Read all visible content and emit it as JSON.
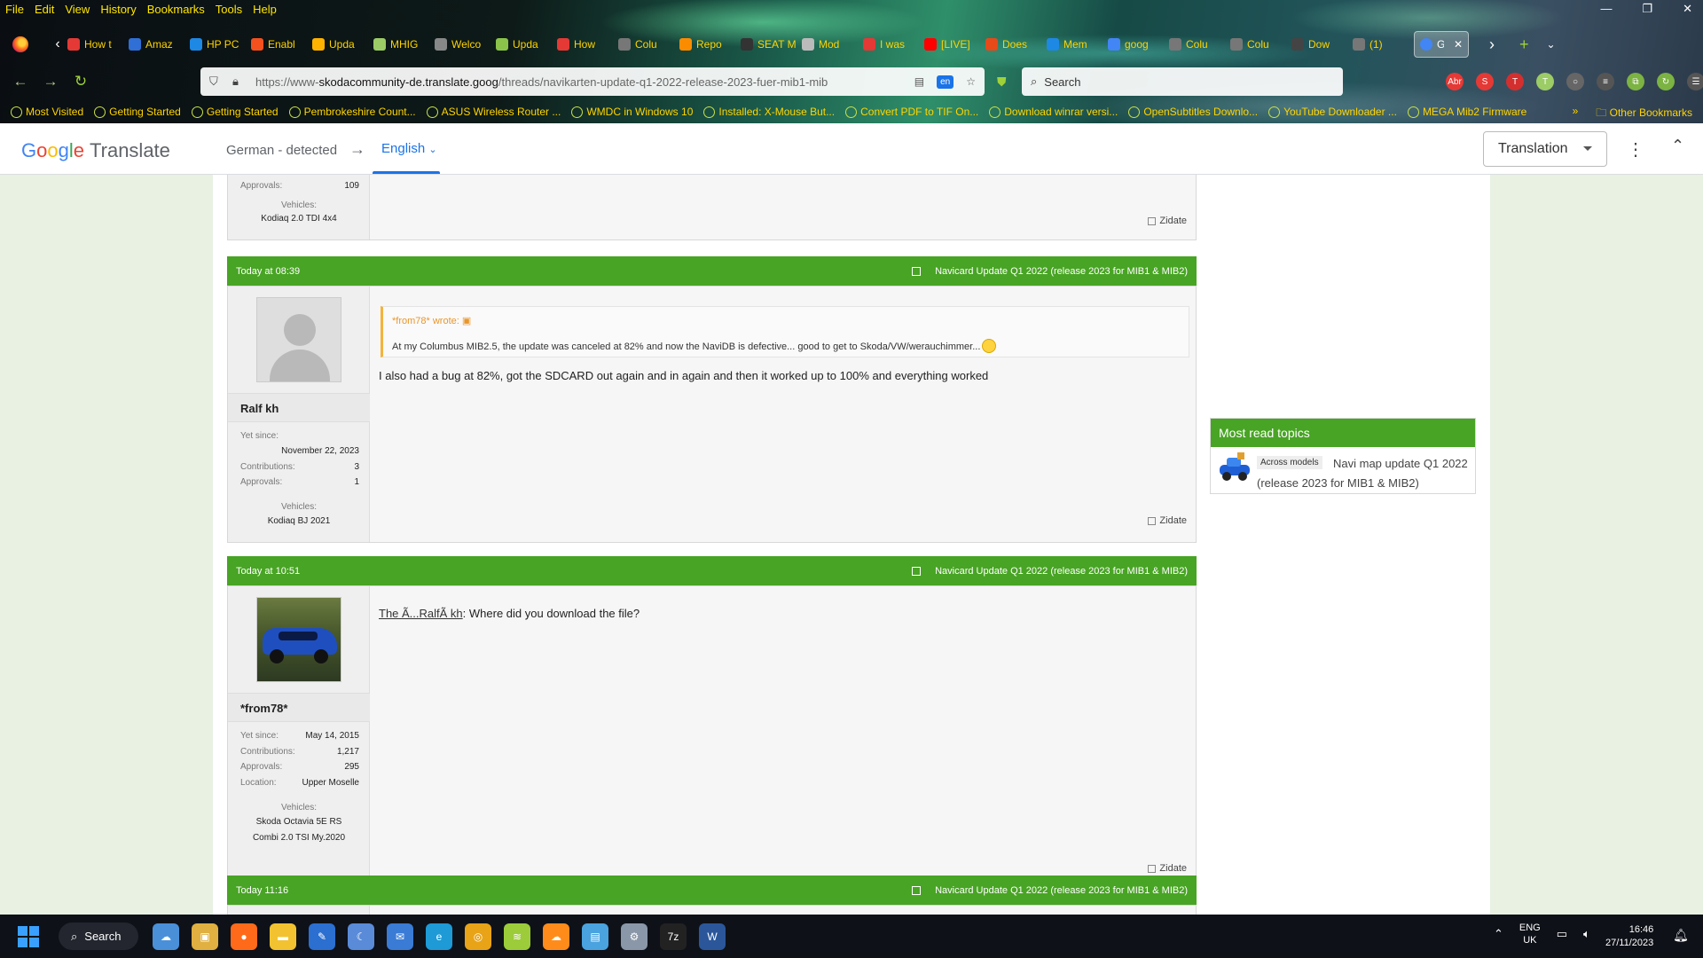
{
  "browser": {
    "menu": [
      "File",
      "Edit",
      "View",
      "History",
      "Bookmarks",
      "Tools",
      "Help"
    ],
    "tabs": [
      {
        "label": "How t",
        "color": "#e53935"
      },
      {
        "label": "Amaz",
        "color": "#2f6fd6"
      },
      {
        "label": "HP PC",
        "color": "#1e88e5"
      },
      {
        "label": "Enabl",
        "color": "#f4511e"
      },
      {
        "label": "Upda",
        "color": "#ffb300"
      },
      {
        "label": "MHIG",
        "color": "#9ccc65"
      },
      {
        "label": "Welco",
        "color": "#888888"
      },
      {
        "label": "Upda",
        "color": "#8bc34a"
      },
      {
        "label": "How",
        "color": "#e53935"
      },
      {
        "label": "Colu",
        "color": "#777777"
      },
      {
        "label": "Repo",
        "color": "#fb8c00"
      },
      {
        "label": "SEAT MIB",
        "color": "#333333"
      },
      {
        "label": "Mod",
        "color": "#bbbbbb"
      },
      {
        "label": "I was",
        "color": "#e53935"
      },
      {
        "label": "[LIVE]",
        "color": "#ff0000"
      },
      {
        "label": "Does",
        "color": "#e64a19"
      },
      {
        "label": "Mem",
        "color": "#1e88e5"
      },
      {
        "label": "goog",
        "color": "#4285f4"
      },
      {
        "label": "Colu",
        "color": "#777777"
      },
      {
        "label": "Colu",
        "color": "#777777"
      },
      {
        "label": "Dow",
        "color": "#444444"
      },
      {
        "label": "(1)",
        "color": "#777777"
      }
    ],
    "active_tab_label": "G",
    "url_prefix": "https://www-",
    "url_domain": "skodacommunity-de.translate.goog",
    "url_path": "/threads/navikarten-update-q1-2022-release-2023-fuer-mib1-mib",
    "translate_badge": "en",
    "search_placeholder": "Search",
    "extensions": [
      {
        "label": "Abr",
        "color": "#e53935"
      },
      {
        "label": "S",
        "color": "#e53935"
      },
      {
        "label": "T",
        "color": "#d32f2f"
      },
      {
        "label": "T",
        "color": "#9ccc65"
      },
      {
        "label": "○",
        "color": "#666666"
      },
      {
        "label": "≡",
        "color": "#555555"
      },
      {
        "label": "⧉",
        "color": "#7cb342"
      },
      {
        "label": "↻",
        "color": "#7cb342"
      },
      {
        "label": "☰",
        "color": "#555555"
      }
    ],
    "bookmarks": [
      "Most Visited",
      "Getting Started",
      "Getting Started",
      "Pembrokeshire Count...",
      "ASUS Wireless Router ...",
      "WMDC in Windows 10",
      "Installed: X-Mouse But...",
      "Convert PDF to TIF On...",
      "Download winrar versi...",
      "OpenSubtitles Downlo...",
      "YouTube Downloader ...",
      "MEGA Mib2 Firmware"
    ],
    "bookmarks_overflow": "»",
    "other_bookmarks": "Other Bookmarks"
  },
  "translate_bar": {
    "logo_g": "G",
    "logo_o1": "o",
    "logo_o2": "o",
    "logo_g2": "g",
    "logo_l": "l",
    "logo_e": "e",
    "logo_word": "Translate",
    "source_lang": "German - detected",
    "arrow": "→",
    "target_lang": "English",
    "mode": "Translation"
  },
  "posts": [
    {
      "approvals_label": "Approvals:",
      "approvals": "109",
      "vehicles_label": "Vehicles:",
      "vehicle": "Kodiaq 2.0 TDI 4x4",
      "zidate": "Zidate"
    },
    {
      "time": "Today at 08:39",
      "topic": "Navicard Update Q1 2022 (release 2023 for MIB1 & MIB2)",
      "username": "Ralf kh",
      "yet_since_label": "Yet since:",
      "yet_since": "November 22, 2023",
      "contrib_label": "Contributions:",
      "contrib": "3",
      "approvals_label": "Approvals:",
      "approvals": "1",
      "vehicles_label": "Vehicles:",
      "vehicle": "Kodiaq BJ 2021",
      "quote_author": "*from78* wrote:",
      "quote_text": "At my Columbus MIB2.5, the update was canceled at 82% and now the NaviDB is defective... good to get to Skoda/VW/werauchimmer...",
      "message": "I also had a bug at 82%, got the SDCARD out again and in again and then it worked up to 100% and everything worked",
      "zidate": "Zidate"
    },
    {
      "time": "Today at 10:51",
      "topic": "Navicard Update Q1 2022 (release 2023 for MIB1 & MIB2)",
      "username": "*from78*",
      "yet_since_label": "Yet since:",
      "yet_since": "May 14, 2015",
      "contrib_label": "Contributions:",
      "contrib": "1,217",
      "approvals_label": "Approvals:",
      "approvals": "295",
      "location_label": "Location:",
      "location": "Upper Moselle",
      "vehicles_label": "Vehicles:",
      "vehicle_line1": "Skoda Octavia 5E RS",
      "vehicle_line2": "Combi 2.0 TSI My.2020",
      "mention": "The Ã...RalfÃ kh",
      "message": ": Where did you download the file?",
      "zidate": "Zidate"
    },
    {
      "time": "Today 11:16",
      "topic": "Navicard Update Q1 2022 (release 2023 for MIB1 & MIB2)"
    }
  ],
  "sidebar": {
    "heading": "Most read topics",
    "tag": "Across models",
    "topic": "Navi map update Q1 2022 (release 2023 for MIB1 & MIB2)"
  },
  "taskbar": {
    "search_label": "Search",
    "apps": [
      {
        "label": "☁",
        "color": "#4a90d9"
      },
      {
        "label": "▣",
        "color": "#e0b040"
      },
      {
        "label": "●",
        "color": "#ff6a1a"
      },
      {
        "label": "▬",
        "color": "#f2c230"
      },
      {
        "label": "✎",
        "color": "#2b6fd1"
      },
      {
        "label": "☾",
        "color": "#5a8bd8"
      },
      {
        "label": "✉",
        "color": "#3a7bd5"
      },
      {
        "label": "e",
        "color": "#1e9ad6"
      },
      {
        "label": "◎",
        "color": "#e8a317"
      },
      {
        "label": "≋",
        "color": "#9ccc3a"
      },
      {
        "label": "☁",
        "color": "#ff8c1a"
      },
      {
        "label": "▤",
        "color": "#4aa3df"
      },
      {
        "label": "⚙",
        "color": "#8a97a8"
      },
      {
        "label": "7z",
        "color": "#222222"
      },
      {
        "label": "W",
        "color": "#2b579a"
      }
    ],
    "lang_top": "ENG",
    "lang_bottom": "UK",
    "time": "16:46",
    "date": "27/11/2023"
  }
}
